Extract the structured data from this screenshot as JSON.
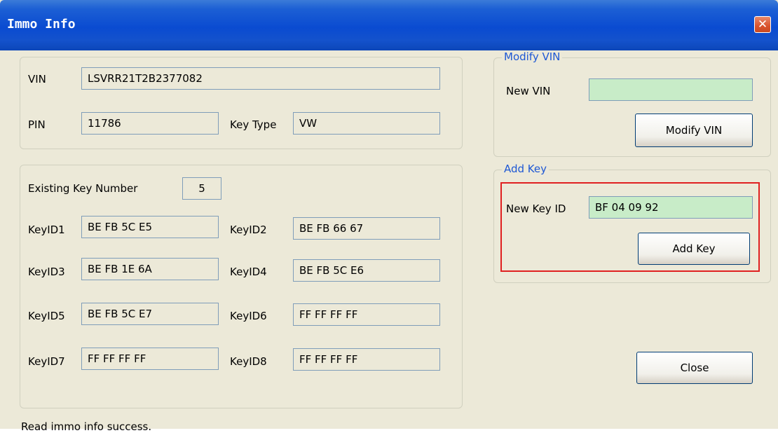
{
  "window": {
    "title": "Immo Info",
    "close_glyph": "✕"
  },
  "info": {
    "vin_label": "VIN",
    "vin_value": "LSVRR21T2B2377082",
    "pin_label": "PIN",
    "pin_value": "11786",
    "key_type_label": "Key Type",
    "key_type_value": "VW"
  },
  "keys": {
    "existing_label": "Existing Key Number",
    "existing_value": "5",
    "items": [
      {
        "label": "KeyID1",
        "value": "BE FB 5C E5"
      },
      {
        "label": "KeyID2",
        "value": "BE FB 66 67"
      },
      {
        "label": "KeyID3",
        "value": "BE FB 1E 6A"
      },
      {
        "label": "KeyID4",
        "value": "BE FB 5C E6"
      },
      {
        "label": "KeyID5",
        "value": "BE FB 5C E7"
      },
      {
        "label": "KeyID6",
        "value": "FF FF FF FF"
      },
      {
        "label": "KeyID7",
        "value": "FF FF FF FF"
      },
      {
        "label": "KeyID8",
        "value": "FF FF FF FF"
      }
    ]
  },
  "modify_vin": {
    "legend": "Modify VIN",
    "new_vin_label": "New VIN",
    "new_vin_value": "",
    "button": "Modify VIN"
  },
  "add_key": {
    "legend": "Add Key",
    "new_key_label": "New Key ID",
    "new_key_value": "BF 04 09 92",
    "button": "Add Key"
  },
  "close_button": "Close",
  "status": "Read immo info success.",
  "colors": {
    "title_bar": "#0a4bd1",
    "face": "#ece9d8",
    "green_field": "#c8ecc8",
    "legend": "#1e58d4",
    "highlight": "#e02020"
  }
}
